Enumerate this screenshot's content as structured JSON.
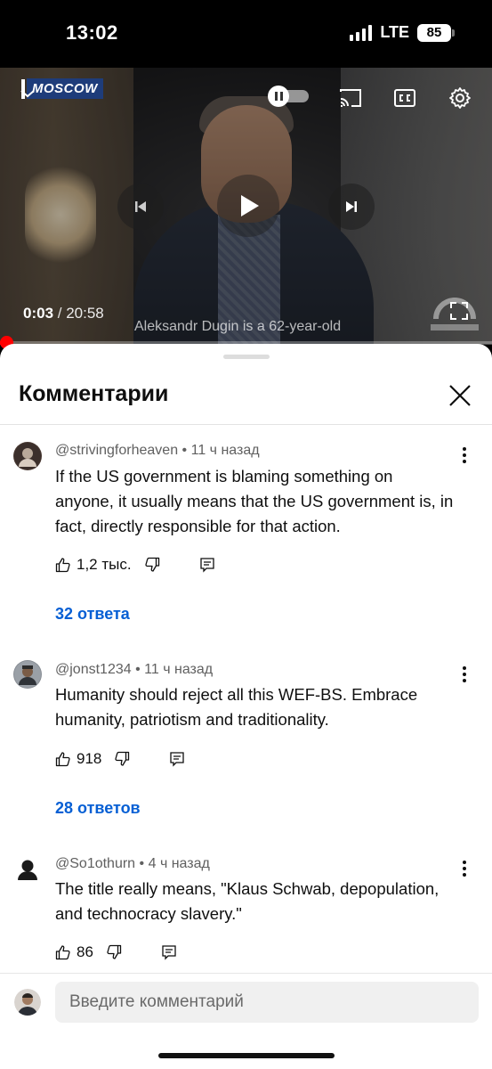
{
  "status_bar": {
    "time": "13:02",
    "network": "LTE",
    "battery": "85"
  },
  "video": {
    "channel_tag": "MOSCOW",
    "current_time": "0:03",
    "separator": " / ",
    "duration": "20:58",
    "subtitle": "Aleksandr Dugin is a 62-year-old",
    "progress_fraction": 0.0024,
    "accent_color": "#ff0000",
    "icons": [
      "chevron-down-icon",
      "autoplay-toggle",
      "cast-icon",
      "cc-icon",
      "gear-icon",
      "previous-icon",
      "play-icon",
      "next-icon",
      "fullscreen-icon"
    ]
  },
  "comments_panel": {
    "title": "Комментарии",
    "close_icon": "close-icon",
    "link_color": "#065fd4",
    "comments": [
      {
        "author": "@strivingforheaven",
        "dot": "•",
        "time": "11 ч назад",
        "text": "If the US government is blaming something on anyone, it usually means that the US government is, in fact, directly responsible for that action.",
        "likes": "1,2 тыс.",
        "replies": "32 ответа"
      },
      {
        "author": "@jonst1234",
        "dot": "•",
        "time": "11 ч назад",
        "text": "Humanity should reject all this WEF-BS. Embrace humanity, patriotism and traditionality.",
        "likes": "918",
        "replies": "28 ответов"
      },
      {
        "author": "@So1othurn",
        "dot": "•",
        "time": "4 ч назад",
        "text": "The title really means, \"Klaus Schwab, depopulation, and technocracy slavery.\"",
        "likes": "86",
        "replies": ""
      }
    ]
  },
  "comment_input": {
    "placeholder": "Введите комментарий"
  }
}
